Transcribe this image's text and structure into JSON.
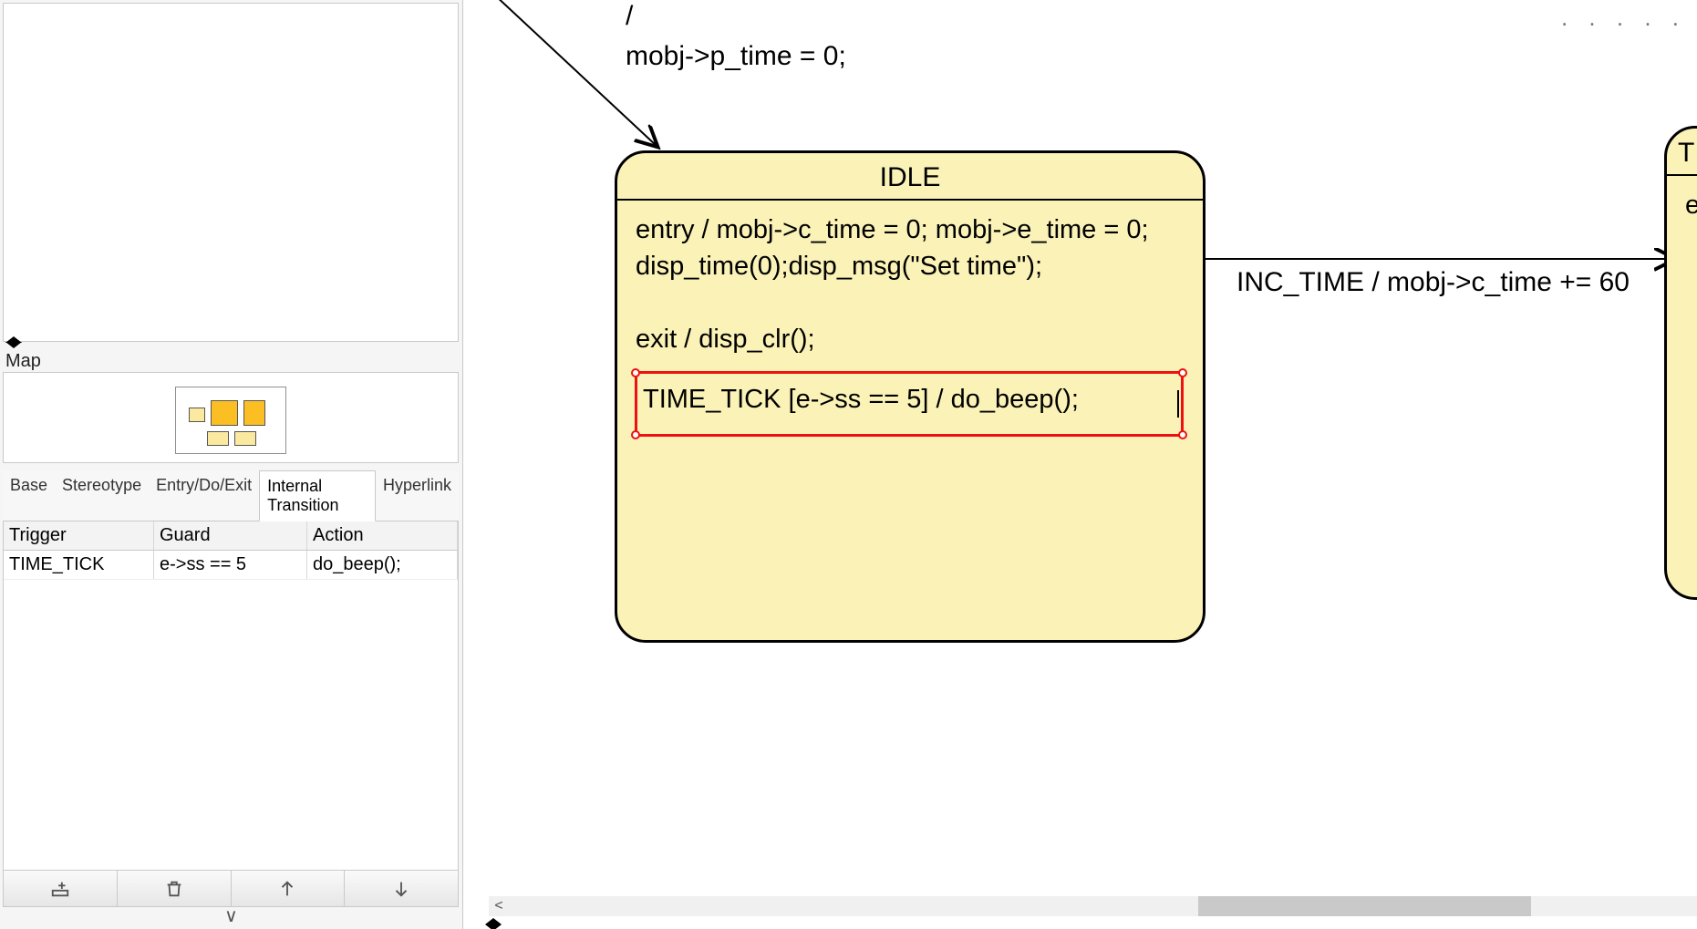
{
  "sidebar": {
    "map_label": "Map",
    "tabs": [
      "Base",
      "Stereotype",
      "Entry/Do/Exit",
      "Internal Transition",
      "Hyperlink"
    ],
    "active_tab": 3,
    "grid": {
      "headers": [
        "Trigger",
        "Guard",
        "Action"
      ],
      "rows": [
        {
          "trigger": "TIME_TICK",
          "guard": "e->ss == 5",
          "action": "do_beep();"
        }
      ]
    },
    "collapse_glyph": "∨"
  },
  "canvas": {
    "initial_slash": "/",
    "initial_action": "mobj->p_time = 0;",
    "idle": {
      "title": "IDLE",
      "entry_line1": "entry / mobj->c_time = 0; mobj->e_time = 0;",
      "entry_line2": "disp_time(0);disp_msg(\"Set time\");",
      "exit": "exit / disp_clr();",
      "internal": "TIME_TICK [e->ss == 5] / do_beep();"
    },
    "other": {
      "title_fragment": "TI",
      "body_fragment": "e"
    },
    "inc_transition": "INC_TIME / mobj->c_time += 60",
    "ruler": ". . . . ."
  },
  "scroll": {
    "left_glyph": "<"
  }
}
